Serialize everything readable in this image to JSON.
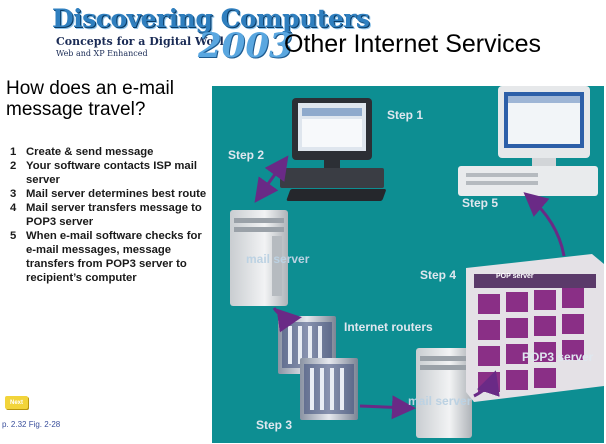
{
  "logo": {
    "word": "Discovering Computers",
    "tagline": "Concepts for a Digital World",
    "edition": "Web and XP Enhanced",
    "year": "2003"
  },
  "title": "Other Internet Services",
  "question": "How does an e-mail message travel?",
  "steps": [
    {
      "num": "1",
      "text": "Create & send  message"
    },
    {
      "num": "2",
      "text": "Your software contacts ISP mail server"
    },
    {
      "num": "3",
      "text": "Mail server determines best route"
    },
    {
      "num": "4",
      "text": "Mail server transfers message to POP3 server"
    },
    {
      "num": "5",
      "text": "When e-mail software checks for e-mail messages, message transfers from POP3 server to recipient’s computer"
    }
  ],
  "next_label": "Next",
  "reference": "p. 2.32 Fig. 2-28",
  "diagram": {
    "step1": "Step 1",
    "step2": "Step 2",
    "step3": "Step 3",
    "step4": "Step 4",
    "step5": "Step 5",
    "mail_server_1": "mail server",
    "internet_routers": "Internet routers",
    "mail_server_2": "mail server",
    "pop3_server": "POP3 server",
    "pop_box_label": "POP server",
    "colors": {
      "background": "#0d8e92",
      "arrow": "#6a2a86",
      "label": "#dfe7ef"
    }
  }
}
